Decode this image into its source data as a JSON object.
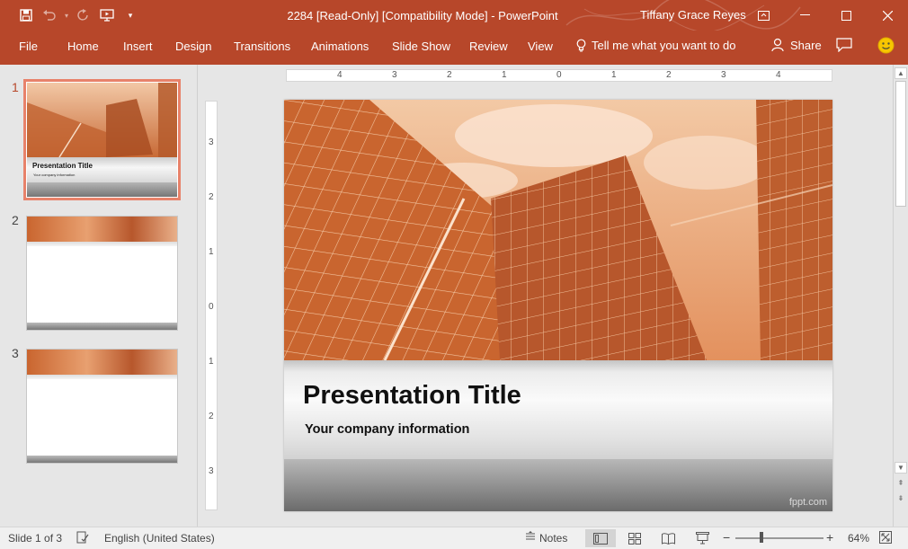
{
  "app": {
    "window_title": "2284 [Read-Only] [Compatibility Mode]  -  PowerPoint",
    "user_name": "Tiffany Grace Reyes",
    "accent_color": "#b7472a"
  },
  "quick_access": {
    "save_icon": "save-icon",
    "undo_icon": "undo-icon",
    "redo_icon": "redo-icon",
    "present_icon": "start-from-beginning-icon",
    "customize_icon": "customize-qat-icon"
  },
  "ribbon": {
    "tabs": [
      "File",
      "Home",
      "Insert",
      "Design",
      "Transitions",
      "Animations",
      "Slide Show",
      "Review",
      "View"
    ],
    "tell_me": "Tell me what you want to do",
    "share": "Share"
  },
  "thumbnails": [
    {
      "number": "1",
      "title": "Presentation Title",
      "subtitle": "Your company information",
      "selected": true
    },
    {
      "number": "2",
      "selected": false
    },
    {
      "number": "3",
      "selected": false
    }
  ],
  "rulers": {
    "horizontal_labels": [
      "4",
      "3",
      "2",
      "1",
      "0",
      "1",
      "2",
      "3",
      "4"
    ],
    "vertical_labels": [
      "3",
      "2",
      "1",
      "0",
      "1",
      "2",
      "3"
    ]
  },
  "slide": {
    "title": "Presentation Title",
    "subtitle": "Your company information",
    "watermark": "fppt.com"
  },
  "status": {
    "slide_indicator": "Slide 1 of 3",
    "language": "English (United States)",
    "notes": "Notes",
    "zoom": "64%",
    "zoom_level_percent": 64
  }
}
